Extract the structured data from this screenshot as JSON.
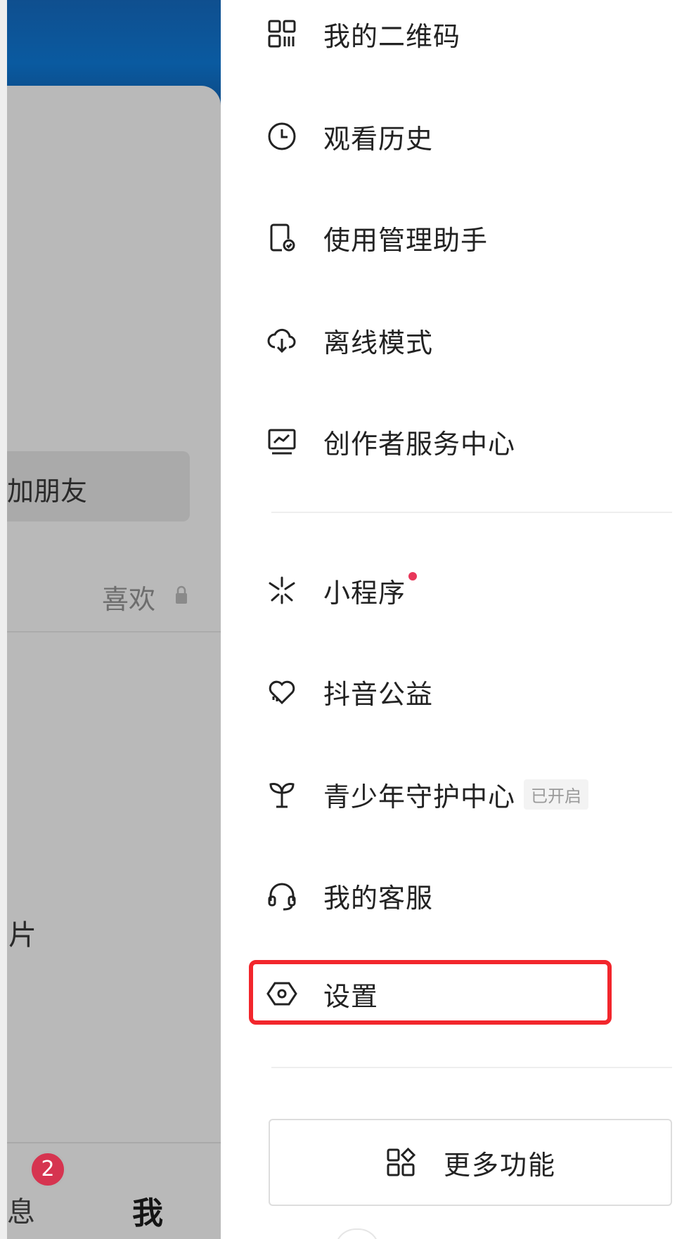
{
  "left_panel": {
    "friend_button_partial": "加朋友",
    "likes_tab": "喜欢",
    "partial_text": "片",
    "bottom_nav": {
      "messages_partial": "息",
      "messages_badge": "2",
      "me": "我"
    }
  },
  "drawer": {
    "items": [
      {
        "label": "我的二维码",
        "icon": "qr-code-icon"
      },
      {
        "label": "观看历史",
        "icon": "clock-icon"
      },
      {
        "label": "使用管理助手",
        "icon": "phone-check-icon"
      },
      {
        "label": "离线模式",
        "icon": "cloud-download-icon"
      },
      {
        "label": "创作者服务中心",
        "icon": "monitor-chart-icon"
      },
      {
        "label": "小程序",
        "icon": "mini-program-icon"
      },
      {
        "label": "抖音公益",
        "icon": "heart-charity-icon"
      },
      {
        "label": "青少年守护中心",
        "icon": "sprout-icon",
        "tag": "已开启"
      },
      {
        "label": "我的客服",
        "icon": "headset-icon"
      },
      {
        "label": "设置",
        "icon": "settings-hexagon-icon"
      }
    ],
    "more_button": {
      "label": "更多功能",
      "icon": "apps-grid-icon"
    }
  },
  "colors": {
    "highlight": "#f2262c",
    "badge": "#d63450",
    "red_dot": "#e8375a"
  }
}
